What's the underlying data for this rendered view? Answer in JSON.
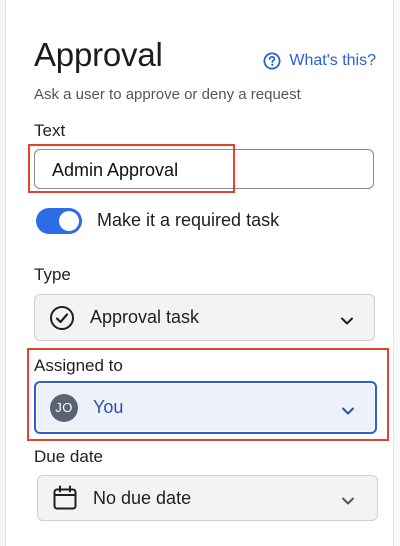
{
  "header": {
    "title": "Approval",
    "help_link": "What's this?",
    "subtitle": "Ask a user to approve or deny a request"
  },
  "text_field": {
    "label": "Text",
    "value": "Admin Approval"
  },
  "required_toggle": {
    "label": "Make it a required task",
    "checked": true
  },
  "type": {
    "label": "Type",
    "value": "Approval task",
    "icon": "check-circle-icon"
  },
  "assigned_to": {
    "label": "Assigned to",
    "initials": "JO",
    "value": "You"
  },
  "due_date": {
    "label": "Due date",
    "value": "No due date",
    "icon": "calendar-icon"
  },
  "colors": {
    "accent": "#2e6ce6",
    "link": "#2b5fd9",
    "highlight": "#e0452b"
  }
}
